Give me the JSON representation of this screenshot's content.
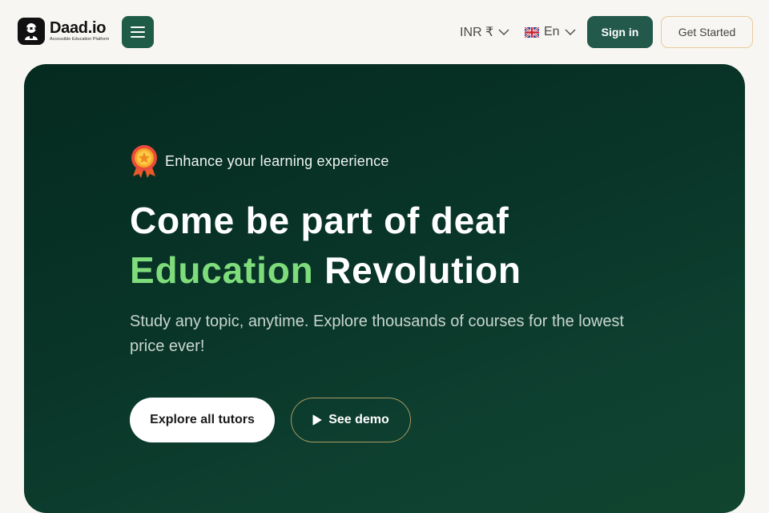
{
  "header": {
    "logo": {
      "name": "Daad.io",
      "tagline": "Accessible Education Platform"
    },
    "currency": {
      "selected": "INR ₹"
    },
    "language": {
      "selected": "En",
      "flag_icon": "uk-flag-icon"
    },
    "signin_label": "Sign in",
    "get_started_label": "Get Started"
  },
  "hero": {
    "badge_text": "Enhance your learning experience",
    "headline_line1": "Come be part of deaf",
    "headline_accent": "Education",
    "headline_rest": "Revolution",
    "subtitle": "Study any topic, anytime. Explore thousands of courses for the lowest price ever!",
    "explore_label": "Explore all tutors",
    "demo_label": "See demo"
  },
  "colors": {
    "brand_green": "#23594a",
    "hero_bg": "#093528",
    "accent_green": "#7fdc7b",
    "get_started_border": "#e8c99a",
    "page_bg": "#f8f6f2"
  }
}
